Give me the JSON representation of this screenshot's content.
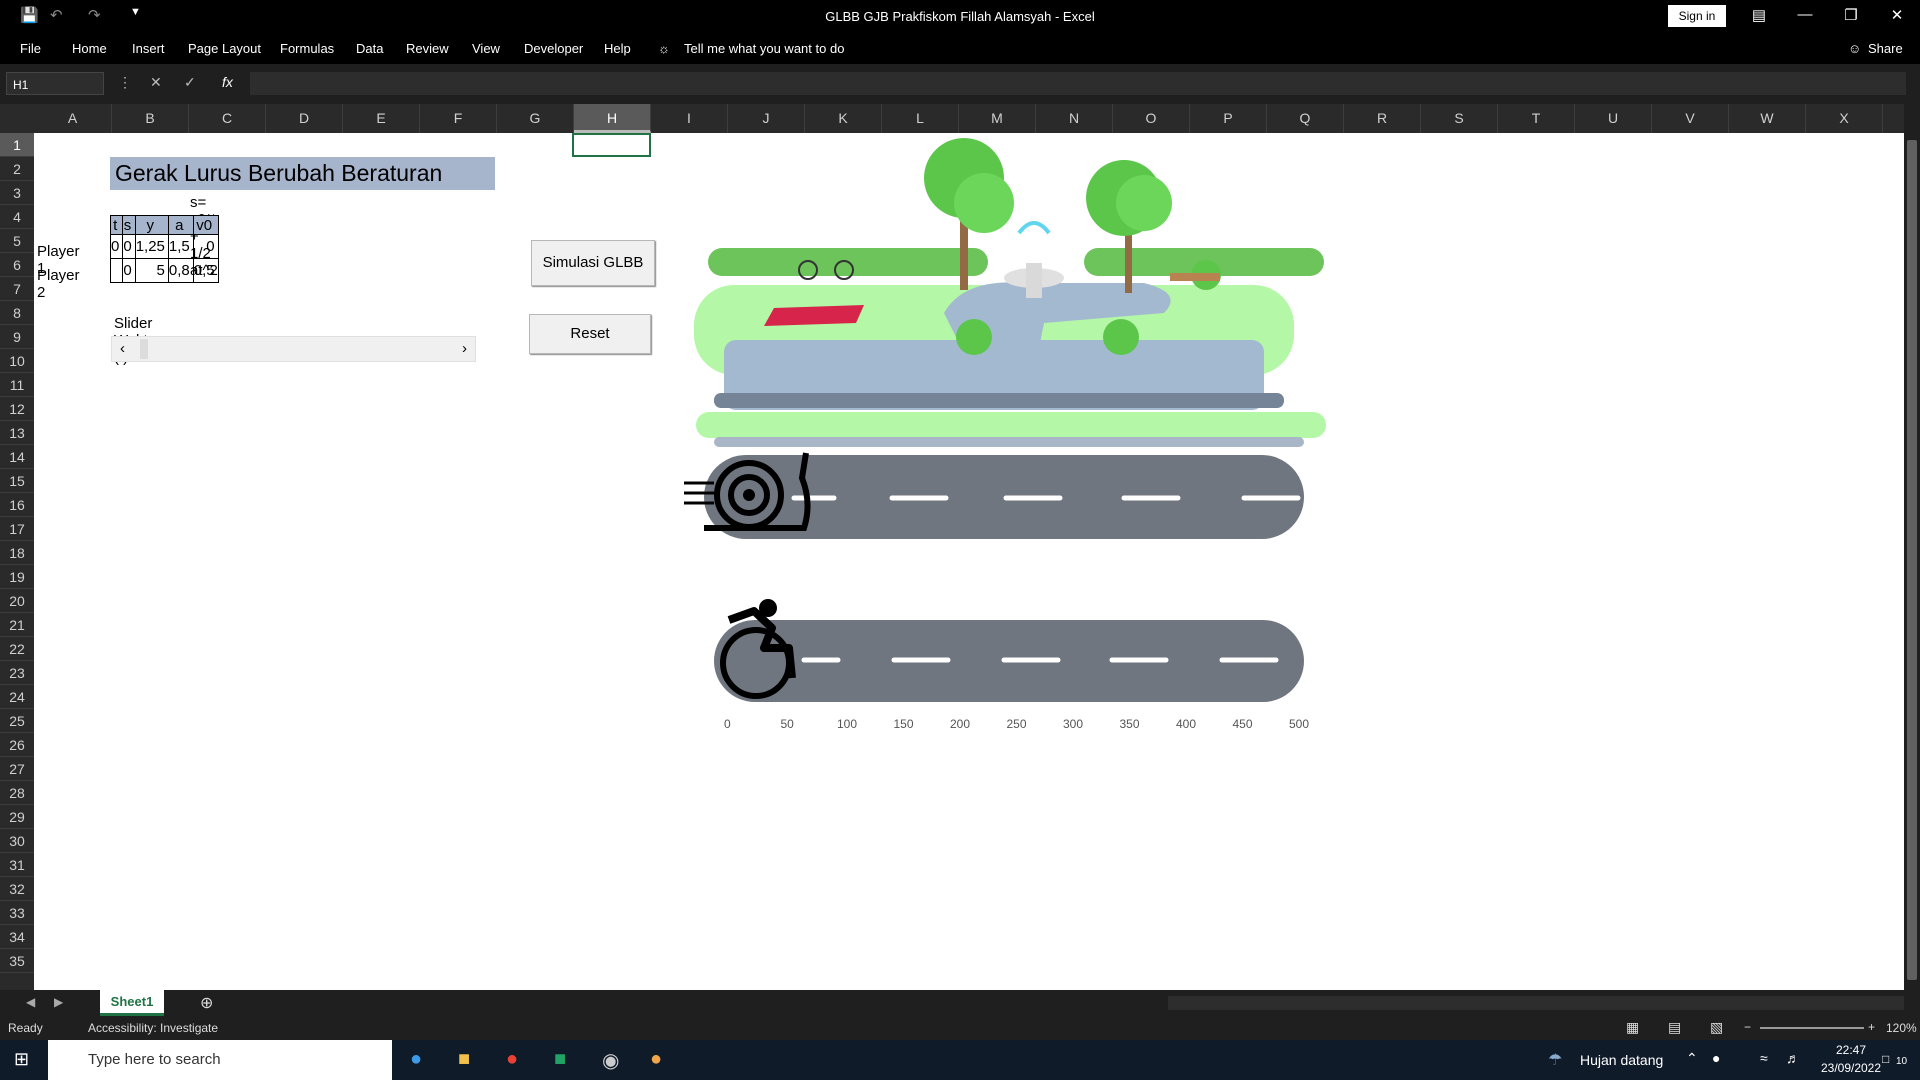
{
  "window": {
    "title": "GLBB GJB Prakfiskom Fillah Alamsyah  -  Excel",
    "sign_in": "Sign in",
    "share": "Share"
  },
  "ribbon": {
    "tabs": [
      "File",
      "Home",
      "Insert",
      "Page Layout",
      "Formulas",
      "Data",
      "Review",
      "View",
      "Developer",
      "Help"
    ],
    "tell_me": "Tell me what you want to do"
  },
  "formula_bar": {
    "name_box": "H1",
    "formula": ""
  },
  "columns": [
    "A",
    "B",
    "C",
    "D",
    "E",
    "F",
    "G",
    "H",
    "I",
    "J",
    "K",
    "L",
    "M",
    "N",
    "O",
    "P",
    "Q",
    "R",
    "S",
    "T",
    "U",
    "V",
    "W",
    "X"
  ],
  "rows": [
    "1",
    "2",
    "3",
    "4",
    "5",
    "6",
    "7",
    "8",
    "9",
    "10",
    "11",
    "12",
    "13",
    "14",
    "15",
    "16",
    "17",
    "18",
    "19",
    "20",
    "21",
    "22",
    "23",
    "24",
    "25",
    "26",
    "27",
    "28",
    "29",
    "30",
    "31",
    "32",
    "33",
    "34",
    "35"
  ],
  "sheet": {
    "title": "Gerak Lurus Berubah Beraturan",
    "formula_text": "s= v0*t + 1/2 at^2",
    "table": {
      "headers": [
        "t",
        "s",
        "y",
        "a",
        "v0"
      ],
      "rows": [
        {
          "label": "Player 1",
          "values": [
            "0",
            "0",
            "1,25",
            "1,5",
            "0"
          ]
        },
        {
          "label": "Player 2",
          "values": [
            "",
            "0",
            "5",
            "0,8",
            "0,5"
          ]
        }
      ]
    },
    "slider_label": "Slider Waktu (t)",
    "slider_value": 0,
    "buttons": {
      "simulate": "Simulasi GLBB",
      "reset": "Reset"
    },
    "axis_ticks": [
      "0",
      "50",
      "100",
      "150",
      "200",
      "250",
      "300",
      "350",
      "400",
      "450",
      "500"
    ]
  },
  "sheet_tab": "Sheet1",
  "status": {
    "ready": "Ready",
    "accessibility": "Accessibility: Investigate",
    "zoom": "120%"
  },
  "taskbar": {
    "search_placeholder": "Type here to search",
    "weather": "Hujan datang",
    "time": "22:47",
    "date": "23/09/2022",
    "notifications": "10"
  }
}
